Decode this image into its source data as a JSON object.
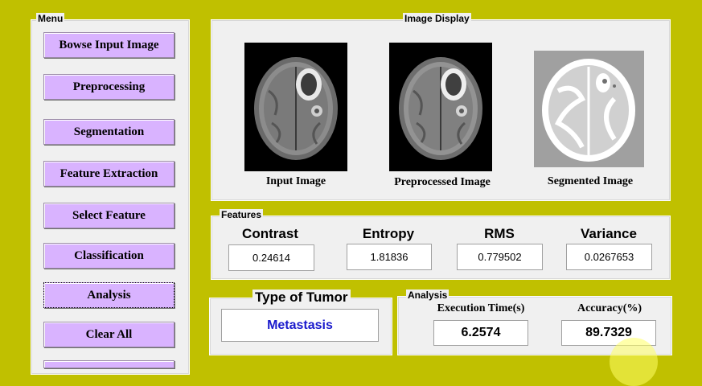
{
  "menu": {
    "title": "Menu",
    "buttons": [
      {
        "label": "Bowse Input Image"
      },
      {
        "label": "Preprocessing"
      },
      {
        "label": "Segmentation"
      },
      {
        "label": "Feature Extraction"
      },
      {
        "label": "Select Feature"
      },
      {
        "label": "Classification"
      },
      {
        "label": "Analysis"
      },
      {
        "label": "Clear All"
      }
    ]
  },
  "image_display": {
    "title": "Image Display",
    "captions": [
      "Input Image",
      "Preprocessed Image",
      "Segmented Image"
    ]
  },
  "features": {
    "title": "Features",
    "items": [
      {
        "label": "Contrast",
        "value": "0.24614"
      },
      {
        "label": "Entropy",
        "value": "1.81836"
      },
      {
        "label": "RMS",
        "value": "0.779502"
      },
      {
        "label": "Variance",
        "value": "0.0267653"
      }
    ]
  },
  "tumor": {
    "title": "Type of Tumor",
    "value": "Metastasis",
    "value_color": "#1a1acc"
  },
  "analysis": {
    "title": "Analysis",
    "exec_label": "Execution Time(s)",
    "exec_value": "6.2574",
    "acc_label": "Accuracy(%)",
    "acc_value": "89.7329"
  },
  "colors": {
    "background": "#c0c000",
    "button": "#d9b3ff",
    "panel": "#f0f0f0"
  }
}
